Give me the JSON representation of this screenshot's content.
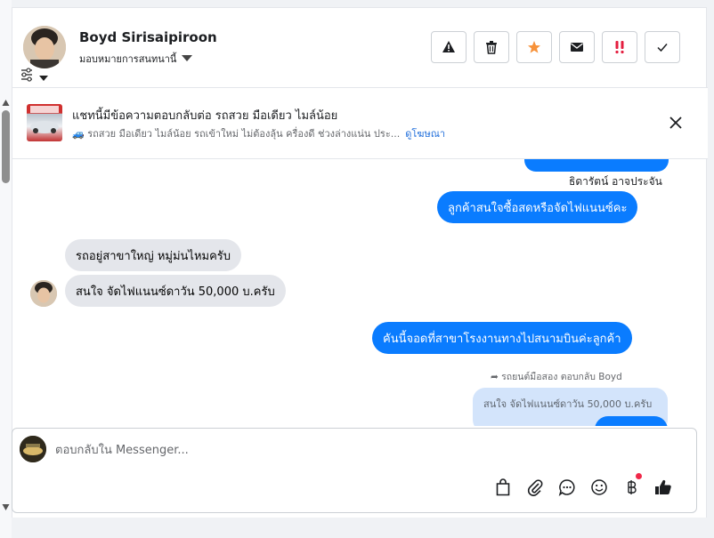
{
  "header": {
    "contact_name": "Boyd Sirisaipiroon",
    "assign_label": "มอบหมายการสนทนานี้"
  },
  "ad": {
    "title": "แชทนี้มีข้อความตอบกลับต่อ รถสวย มือเดียว ไมล์น้อย",
    "subtitle": "🚙 รถสวย มือเดียว ไมล์น้อย รถเข้าใหม่ ไม่ต้องลุ้น ครื่องดี ช่วงล่างแน่น ประ...",
    "link": "ดูโฆษณา"
  },
  "messages": {
    "sender_name": "ธิดารัตน์ อาจประจัน",
    "out_1": "ลูกค้าสนใจซื้อสดหรือจัดไฟแนนซ์คะ",
    "in_1": "รถอยู่สาขาใหญ่ หมู่ม่นไหมครับ",
    "in_2": "สนใจ จัดไฟแนนซ์ดาวัน 50,000 บ.ครับ",
    "out_2": "คันนี้จอดที่สาขาโรงงานทางไปสนามบินค่ะลูกค้า",
    "reply_label": "รถยนต์มือสอง ตอบกลับ Boyd",
    "quoted": "สนใจ จัดไฟแนนซ์ดาวัน 50,000 บ.ครับ"
  },
  "composer": {
    "placeholder": "ตอบกลับใน Messenger..."
  },
  "colors": {
    "accent": "#0a7cff",
    "incoming": "#e4e6eb",
    "quoted": "#d3e4fb",
    "star": "#f7923a",
    "urgent": "#e41e3f",
    "badge": "#f02849"
  }
}
